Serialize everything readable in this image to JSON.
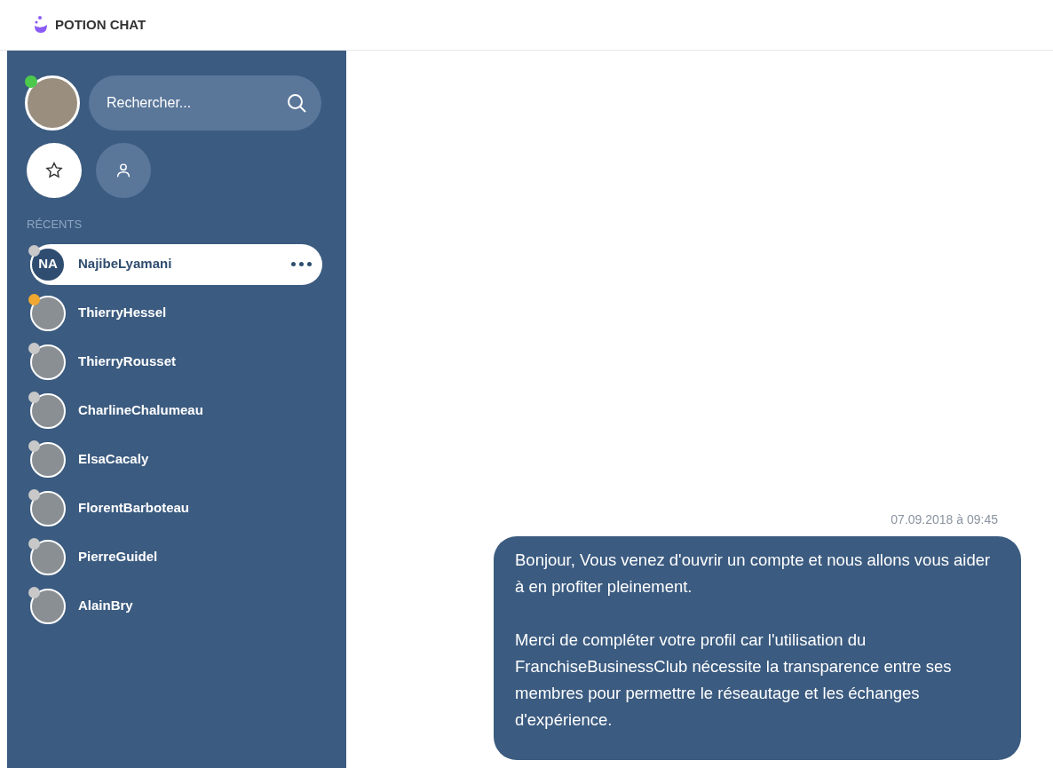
{
  "app": {
    "title": "POTION CHAT"
  },
  "user": {
    "online": true
  },
  "search": {
    "placeholder": "Rechercher..."
  },
  "filters": [
    {
      "kind": "favorites",
      "selected": true
    },
    {
      "kind": "contacts",
      "selected": false
    }
  ],
  "section_label": "RÉCENTS",
  "contacts": [
    {
      "name": "NajibeLyamani",
      "initials": "NA",
      "color": "#c8c8c8",
      "selected": true
    },
    {
      "name": "ThierryHessel",
      "color": "#f0a830",
      "selected": false
    },
    {
      "name": "ThierryRousset",
      "color": "#c8c8c8",
      "selected": false
    },
    {
      "name": "CharlineChalumeau",
      "color": "#c8c8c8",
      "selected": false
    },
    {
      "name": "ElsaCacaly",
      "color": "#c8c8c8",
      "selected": false
    },
    {
      "name": "FlorentBarboteau",
      "color": "#c8c8c8",
      "selected": false
    },
    {
      "name": "PierreGuidel",
      "color": "#c8c8c8",
      "selected": false
    },
    {
      "name": "AlainBry",
      "color": "#c8c8c8",
      "selected": false
    }
  ],
  "messages": [
    {
      "time": "07.09.2018 à 09:45",
      "paragraphs": [
        "Bonjour, Vous venez d'ouvrir un compte et nous allons vous aider à en profiter pleinement.",
        "Merci de compléter votre profil car l'utilisation du FranchiseBusinessClub nécessite la transparence entre ses membres pour permettre le réseautage et les échanges d'expérience."
      ]
    }
  ]
}
